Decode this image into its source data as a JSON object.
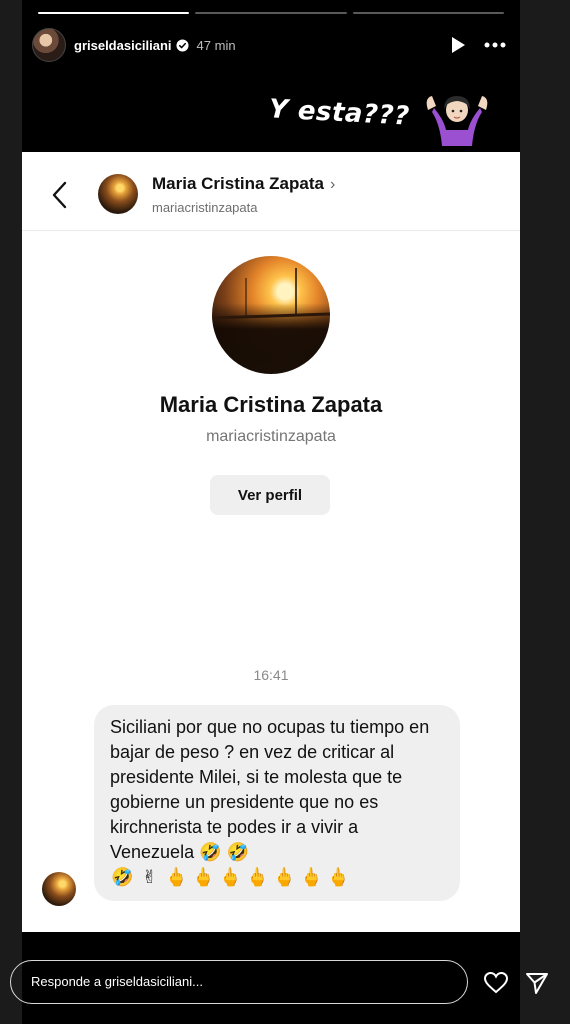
{
  "story": {
    "progress": [
      1,
      0,
      0
    ],
    "username": "griseldasiciliani",
    "time": "47 min",
    "caption": "Y esta???"
  },
  "chat": {
    "contact_name": "Maria Cristina Zapata",
    "contact_username": "mariacristinzapata",
    "view_profile_label": "Ver perfil",
    "timestamp": "16:41",
    "message_text": "Siciliani por que no ocupas tu tiempo en bajar de peso ? en vez de criticar al presidente Milei, si te molesta que te gobierne un presidente que no es kirchnerista te podes ir a vivir a Venezuela",
    "message_emojis_inline": "🤣 🤣",
    "message_emojis_row": [
      "🤣",
      "✌",
      "🖕",
      "🖕",
      "🖕",
      "🖕",
      "🖕",
      "🖕",
      "🖕"
    ]
  },
  "reply": {
    "placeholder": "Responde a griseldasiciliani..."
  }
}
